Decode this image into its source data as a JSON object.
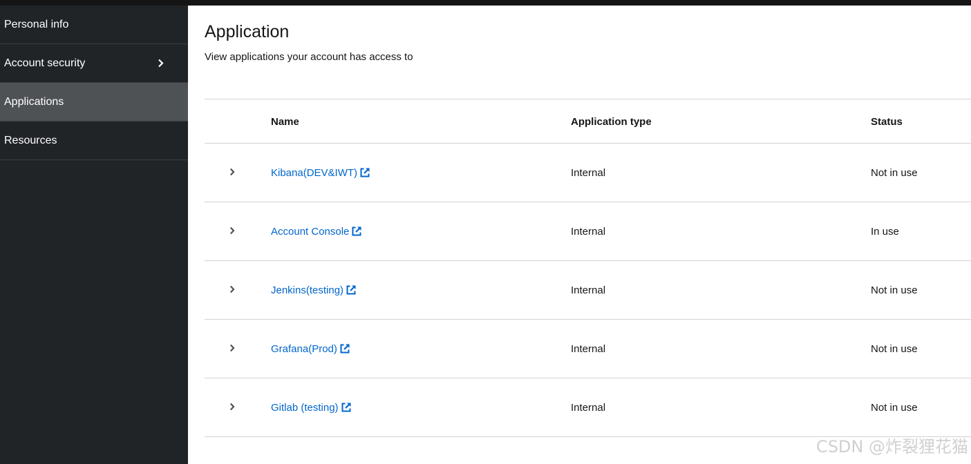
{
  "sidebar": {
    "items": [
      {
        "label": "Personal info"
      },
      {
        "label": "Account security"
      },
      {
        "label": "Applications"
      },
      {
        "label": "Resources"
      }
    ]
  },
  "page": {
    "title": "Application",
    "subtitle": "View applications your account has access to"
  },
  "table": {
    "columns": {
      "name": "Name",
      "type": "Application type",
      "status": "Status"
    },
    "rows": [
      {
        "name": "Kibana(DEV&IWT)",
        "type": "Internal",
        "status": "Not in use"
      },
      {
        "name": "Account Console",
        "type": "Internal",
        "status": "In use"
      },
      {
        "name": "Jenkins(testing)",
        "type": "Internal",
        "status": "Not in use"
      },
      {
        "name": "Grafana(Prod)",
        "type": "Internal",
        "status": "Not in use"
      },
      {
        "name": "Gitlab (testing)",
        "type": "Internal",
        "status": "Not in use"
      }
    ]
  },
  "watermark": "CSDN @炸裂狸花猫",
  "colors": {
    "sidebar_bg": "#212427",
    "sidebar_active": "#4f5255",
    "link": "#0066cc",
    "divider": "#d2d2d2"
  }
}
